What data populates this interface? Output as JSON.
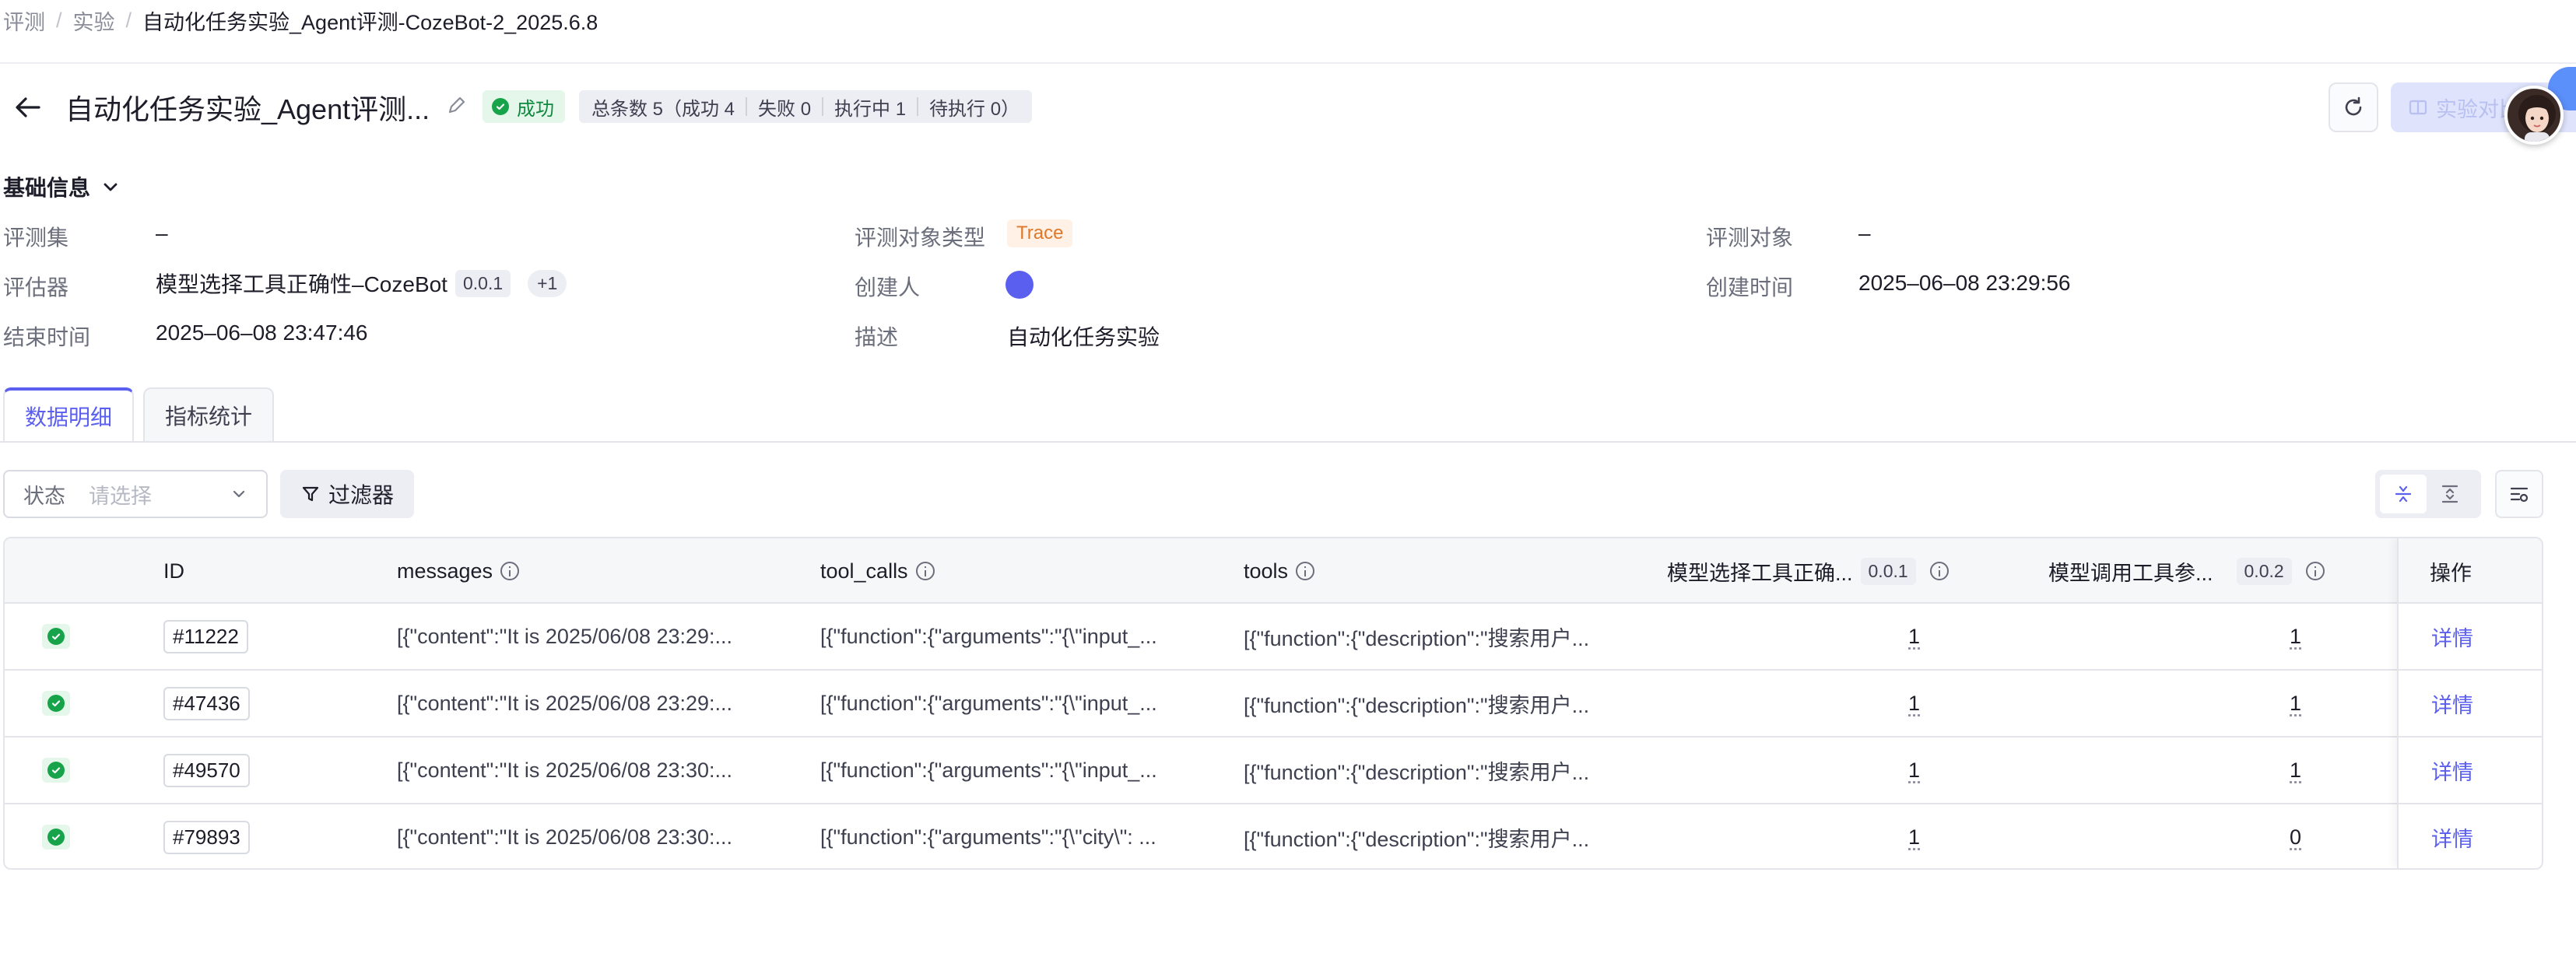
{
  "breadcrumb": [
    "评测",
    "实验",
    "自动化任务实验_Agent评测-CozeBot-2_2025.6.8"
  ],
  "header": {
    "title": "自动化任务实验_Agent评测...",
    "status": "成功",
    "stats": {
      "total": "总条数 5（成功 4",
      "failed": "失败 0",
      "running": "执行中 1",
      "pending": "待执行 0）"
    },
    "compare_button": "实验对比"
  },
  "basic_info": {
    "title": "基础信息",
    "eval_set_label": "评测集",
    "eval_set_value": "–",
    "target_type_label": "评测对象类型",
    "target_type_value": "Trace",
    "target_label": "评测对象",
    "target_value": "–",
    "evaluator_label": "评估器",
    "evaluator_value": "模型选择工具正确性–CozeBot",
    "evaluator_version": "0.0.1",
    "evaluator_more": "+1",
    "creator_label": "创建人",
    "created_time_label": "创建时间",
    "created_time_value": "2025–06–08 23:29:56",
    "end_time_label": "结束时间",
    "end_time_value": "2025–06–08 23:47:46",
    "description_label": "描述",
    "description_value": "自动化任务实验"
  },
  "tabs": [
    {
      "label": "数据明细",
      "active": true
    },
    {
      "label": "指标统计",
      "active": false
    }
  ],
  "filters": {
    "status_label": "状态",
    "status_placeholder": "请选择",
    "filter_button": "过滤器"
  },
  "table": {
    "columns": {
      "id": "ID",
      "messages": "messages",
      "tool_calls": "tool_calls",
      "tools": "tools",
      "eval1": "模型选择工具正确...",
      "eval1_version": "0.0.1",
      "eval2": "模型调用工具参...",
      "eval2_version": "0.0.2",
      "actions": "操作"
    },
    "rows": [
      {
        "id": "#11222",
        "messages": "[{\"content\":\"It is 2025/06/08 23:29:...",
        "tool_calls": "[{\"function\":{\"arguments\":\"{\\\"input_...",
        "tools": "[{\"function\":{\"description\":\"搜索用户...",
        "score1": "1",
        "score2": "1",
        "action": "详情"
      },
      {
        "id": "#47436",
        "messages": "[{\"content\":\"It is 2025/06/08 23:29:...",
        "tool_calls": "[{\"function\":{\"arguments\":\"{\\\"input_...",
        "tools": "[{\"function\":{\"description\":\"搜索用户...",
        "score1": "1",
        "score2": "1",
        "action": "详情"
      },
      {
        "id": "#49570",
        "messages": "[{\"content\":\"It is 2025/06/08 23:30:...",
        "tool_calls": "[{\"function\":{\"arguments\":\"{\\\"input_...",
        "tools": "[{\"function\":{\"description\":\"搜索用户...",
        "score1": "1",
        "score2": "1",
        "action": "详情"
      },
      {
        "id": "#79893",
        "messages": "[{\"content\":\"It is 2025/06/08 23:30:...",
        "tool_calls": "[{\"function\":{\"arguments\":\"{\\\"city\\\": ...",
        "tools": "[{\"function\":{\"description\":\"搜索用户...",
        "score1": "1",
        "score2": "0",
        "action": "详情"
      }
    ]
  },
  "colors": {
    "accent": "#5b5ff0",
    "success": "#17a34a",
    "trace_tag": "#e0782a"
  },
  "icons": [
    "back-arrow-icon",
    "edit-icon",
    "check-circle-icon",
    "refresh-icon",
    "compare-icon",
    "chevron-down-icon",
    "filter-icon",
    "compact-view-icon",
    "expand-view-icon",
    "column-settings-icon",
    "info-icon"
  ]
}
